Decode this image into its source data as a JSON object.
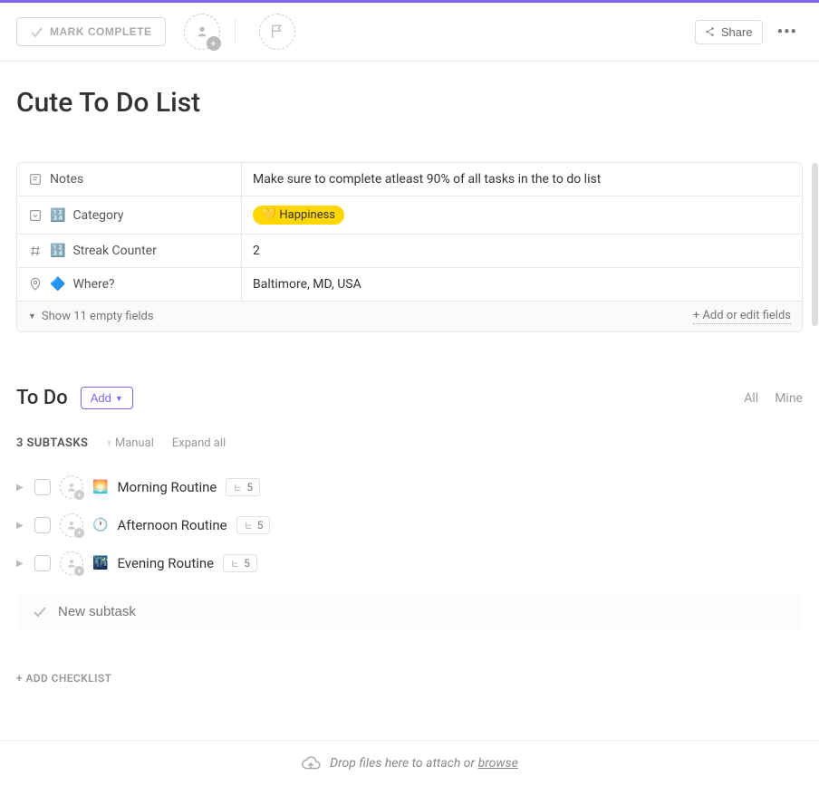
{
  "toolbar": {
    "mark_complete": "MARK COMPLETE",
    "share_label": "Share"
  },
  "page": {
    "title": "Cute To Do List"
  },
  "fields": {
    "notes_label": "Notes",
    "notes_value": "Make sure to complete atleast 90% of all tasks in the to do list",
    "category_emoji": "🔢",
    "category_label": "Category",
    "category_value": "💛 Happiness",
    "streak_emoji": "🔢",
    "streak_label": "Streak Counter",
    "streak_value": "2",
    "where_emoji": "🔷",
    "where_label": "Where?",
    "where_value": "Baltimore, MD, USA"
  },
  "fields_footer": {
    "show_empty": "Show 11 empty fields",
    "add_edit": "+ Add or edit fields"
  },
  "section": {
    "title": "To Do",
    "add_label": "Add",
    "filter_all": "All",
    "filter_mine": "Mine"
  },
  "subtasks": {
    "count_label": "3 SUBTASKS",
    "sort_label": "Manual",
    "expand_label": "Expand all",
    "items": [
      {
        "emoji": "🌅",
        "name": "Morning Routine",
        "count": "5"
      },
      {
        "emoji": "🕐",
        "name": "Afternoon Routine",
        "count": "5"
      },
      {
        "emoji": "🌃",
        "name": "Evening Routine",
        "count": "5"
      }
    ],
    "new_placeholder": "New subtask"
  },
  "checklist": {
    "add_label": "+ ADD CHECKLIST"
  },
  "dropzone": {
    "text": "Drop files here to attach or ",
    "browse": "browse"
  }
}
